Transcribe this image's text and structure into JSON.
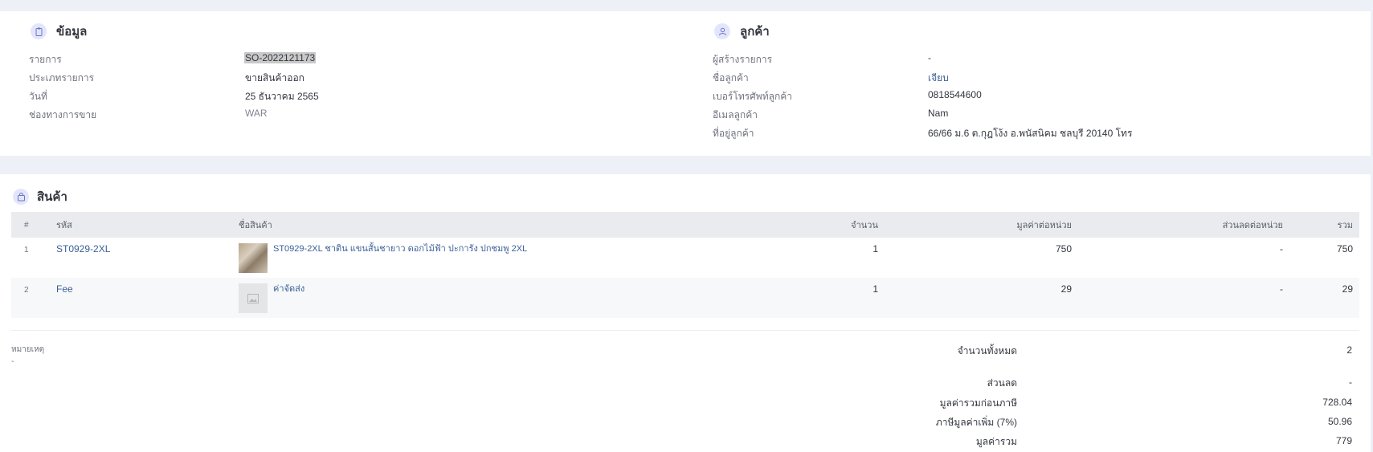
{
  "info": {
    "title": "ข้อมูล",
    "rows": [
      {
        "label": "รายการ",
        "value": "SO-2022121173"
      },
      {
        "label": "ประเภทรายการ",
        "value": "ขายสินค้าออก"
      },
      {
        "label": "วันที่",
        "value": "25 ธันวาคม 2565"
      },
      {
        "label": "ช่องทางการขาย",
        "value": "WAR"
      }
    ]
  },
  "customer": {
    "title": "ลูกค้า",
    "rows": [
      {
        "label": "ผู้สร้างรายการ",
        "value": "-"
      },
      {
        "label": "ชื่อลูกค้า",
        "value": "เจียบ"
      },
      {
        "label": "เบอร์โทรศัพท์ลูกค้า",
        "value": "0818544600"
      },
      {
        "label": "อีเมลลูกค้า",
        "value": "Nam"
      },
      {
        "label": "ที่อยู่ลูกค้า",
        "value": "66/66 ม.6 ต.กุฎโง้ง อ.พนัสนิคม ชลบุรี 20140 โทร"
      }
    ]
  },
  "products": {
    "title": "สินค้า",
    "columns": {
      "index": "#",
      "code": "รหัส",
      "name": "ชื่อสินค้า",
      "qty": "จำนวน",
      "unit_price": "มูลค่าต่อหน่วย",
      "discount": "ส่วนลดต่อหน่วย",
      "total": "รวม"
    },
    "rows": [
      {
        "index": "1",
        "code": "ST0929-2XL",
        "name": "ST0929-2XL ชาติน แขนสั้นชายาว ดอกไม้ฟ้า ปะการัง ปกชมพู 2XL",
        "qty": "1",
        "unit_price": "750",
        "discount": "-",
        "total": "750"
      },
      {
        "index": "2",
        "code": "Fee",
        "name": "ค่าจัดส่ง",
        "qty": "1",
        "unit_price": "29",
        "discount": "-",
        "total": "29"
      }
    ]
  },
  "note": {
    "label": "หมายเหตุ",
    "value": "-"
  },
  "summary": [
    {
      "label": "จำนวนทั้งหมด",
      "value": "2"
    },
    {
      "label": "ส่วนลด",
      "value": "-"
    },
    {
      "label": "มูลค่ารวมก่อนภาษี",
      "value": "728.04"
    },
    {
      "label": "ภาษีมูลค่าเพิ่ม (7%)",
      "value": "50.96"
    },
    {
      "label": "มูลค่ารวม",
      "value": "779"
    }
  ]
}
